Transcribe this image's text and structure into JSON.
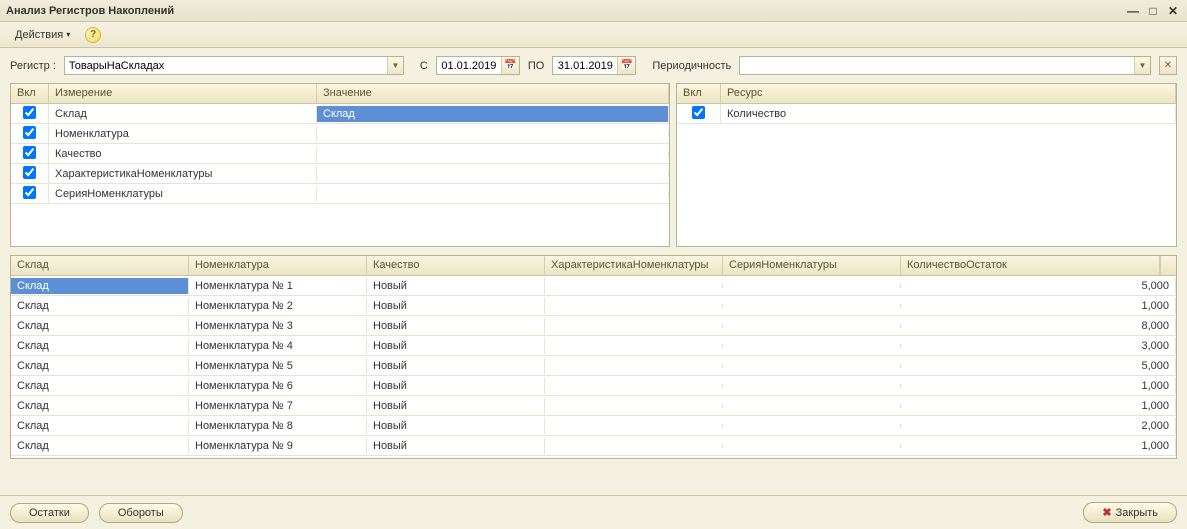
{
  "window": {
    "title": "Анализ Регистров Накоплений"
  },
  "toolbar": {
    "actions_label": "Действия"
  },
  "filters": {
    "register_label": "Регистр :",
    "register_value": "ТоварыНаСкладах",
    "from_label": "С",
    "date_from": "01.01.2019",
    "to_label": "ПО",
    "date_to": "31.01.2019",
    "periodicity_label": "Периодичность",
    "periodicity_value": ""
  },
  "dimensions": {
    "headers": {
      "incl": "Вкл",
      "dim": "Измерение",
      "val": "Значение"
    },
    "rows": [
      {
        "checked": true,
        "dim": "Склад",
        "val": "Склад",
        "selected": true
      },
      {
        "checked": true,
        "dim": "Номенклатура",
        "val": ""
      },
      {
        "checked": true,
        "dim": "Качество",
        "val": ""
      },
      {
        "checked": true,
        "dim": "ХарактеристикаНоменклатуры",
        "val": ""
      },
      {
        "checked": true,
        "dim": "СерияНоменклатуры",
        "val": ""
      }
    ]
  },
  "resources": {
    "headers": {
      "incl": "Вкл",
      "res": "Ресурс"
    },
    "rows": [
      {
        "checked": true,
        "res": "Количество"
      }
    ]
  },
  "data": {
    "headers": {
      "sklad": "Склад",
      "nomen": "Номенклатура",
      "qual": "Качество",
      "char": "ХарактеристикаНоменклатуры",
      "ser": "СерияНоменклатуры",
      "ost": "КоличествоОстаток"
    },
    "rows": [
      {
        "sklad": "Склад",
        "nomen": "Номенклатура №  1",
        "qual": "Новый",
        "char": "",
        "ser": "",
        "ost": "5,000",
        "selected": true
      },
      {
        "sklad": "Склад",
        "nomen": "Номенклатура №  2",
        "qual": "Новый",
        "char": "",
        "ser": "",
        "ost": "1,000"
      },
      {
        "sklad": "Склад",
        "nomen": "Номенклатура №  3",
        "qual": "Новый",
        "char": "",
        "ser": "",
        "ost": "8,000"
      },
      {
        "sklad": "Склад",
        "nomen": "Номенклатура №  4",
        "qual": "Новый",
        "char": "",
        "ser": "",
        "ost": "3,000"
      },
      {
        "sklad": "Склад",
        "nomen": "Номенклатура №  5",
        "qual": "Новый",
        "char": "",
        "ser": "",
        "ost": "5,000"
      },
      {
        "sklad": "Склад",
        "nomen": "Номенклатура №  6",
        "qual": "Новый",
        "char": "",
        "ser": "",
        "ost": "1,000"
      },
      {
        "sklad": "Склад",
        "nomen": "Номенклатура №  7",
        "qual": "Новый",
        "char": "",
        "ser": "",
        "ost": "1,000"
      },
      {
        "sklad": "Склад",
        "nomen": "Номенклатура №  8",
        "qual": "Новый",
        "char": "",
        "ser": "",
        "ost": "2,000"
      },
      {
        "sklad": "Склад",
        "nomen": "Номенклатура №  9",
        "qual": "Новый",
        "char": "",
        "ser": "",
        "ost": "1,000"
      }
    ]
  },
  "footer": {
    "balances_label": "Остатки",
    "turnovers_label": "Обороты",
    "close_label": "Закрыть"
  }
}
